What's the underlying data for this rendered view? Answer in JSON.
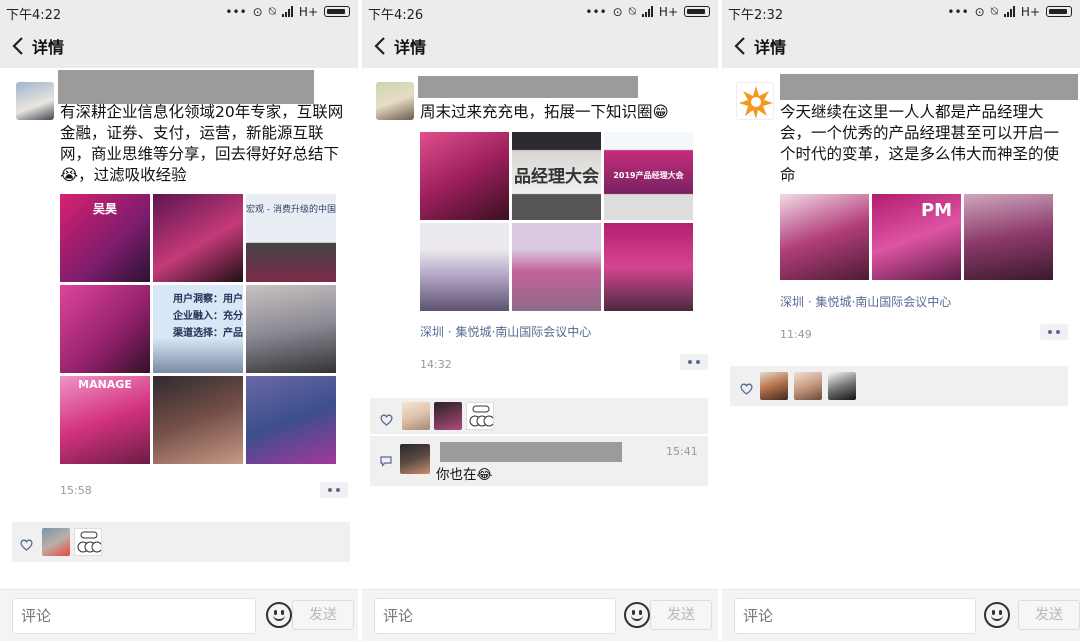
{
  "panels": [
    {
      "status_time": "下午4:22",
      "nav_title": "详情",
      "post_text": "有深耕企业信息化领域20年专家，互联网金融，证券、支付，运营，新能源互联网，商业思维等分享，回去得好好总结下😭，过滤吸收经验",
      "image_overlays": [
        "吴昊",
        "",
        "宏观 - 消费升级的中国",
        "",
        "用户洞察：用户\n企业融入：充分\n渠道选择：产品",
        "",
        "MANAGE",
        "",
        ""
      ],
      "time": "15:58",
      "likes_icon": "heart-icon"
    },
    {
      "status_time": "下午4:26",
      "nav_title": "详情",
      "post_text": "周末过来充充电，拓展一下知识圈😁",
      "image_overlays": [
        "",
        "品经理大会",
        "2019产品经理大会",
        "",
        "",
        "",
        "",
        "",
        ""
      ],
      "location": "深圳 · 集悦城·南山国际会议中心",
      "time": "14:32",
      "comment_time": "15:41",
      "comment_text": "你也在😂"
    },
    {
      "status_time": "下午2:32",
      "nav_title": "详情",
      "post_text": "今天继续在这里一人人都是产品经理大会，一个优秀的产品经理甚至可以开启一个时代的变革，这是多么伟大而神圣的使命",
      "image_overlays": [
        "",
        "PM",
        ""
      ],
      "location": "深圳 · 集悦城·南山国际会议中心",
      "time": "11:49"
    }
  ],
  "status": {
    "network": "H+"
  },
  "bottom": {
    "comment_placeholder": "评论",
    "send_label": "发送"
  },
  "colors": {
    "link": "#576b95",
    "bar": "#ececec",
    "likes_bg": "#f0f0f0"
  }
}
